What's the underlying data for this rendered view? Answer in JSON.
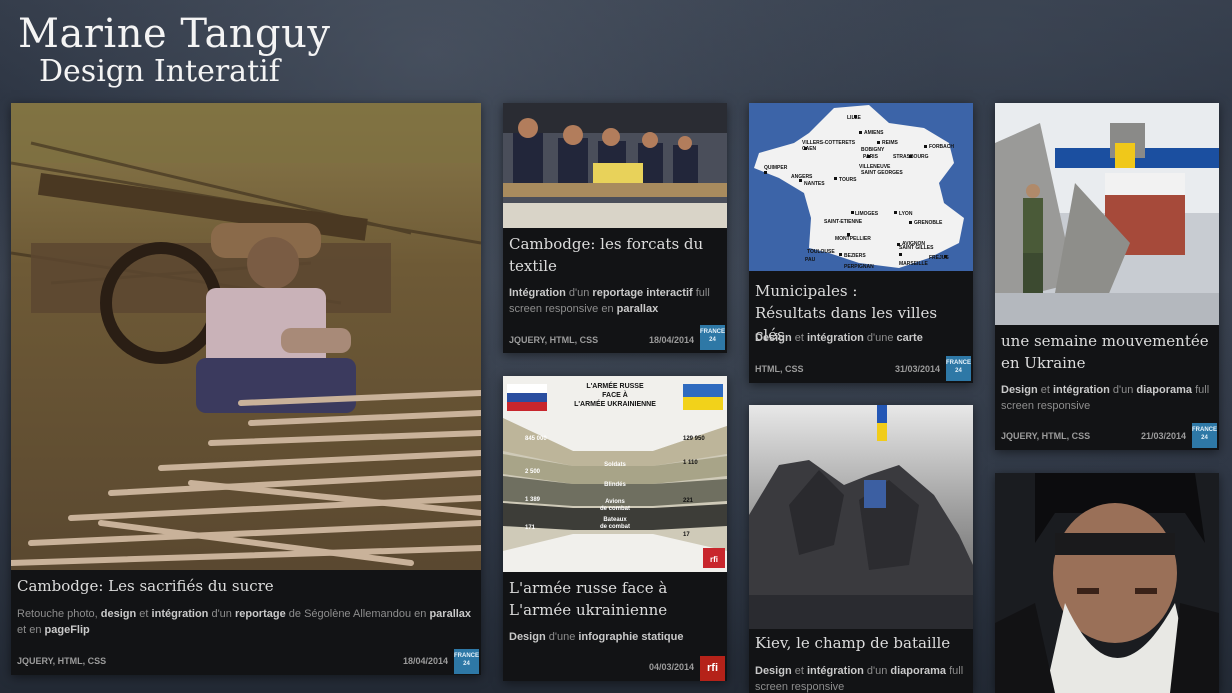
{
  "header": {
    "name": "Marine Tanguy",
    "subtitle": "Design Interatif"
  },
  "cards": [
    {
      "title": "Cambodge: Les sacrifiés du sucre",
      "desc": [
        {
          "t": "Retouche photo",
          "b": false
        },
        {
          "t": ", ",
          "b": false
        },
        {
          "t": "design",
          "b": true
        },
        {
          "t": " et ",
          "b": false
        },
        {
          "t": "intégration",
          "b": true
        },
        {
          "t": " d'un ",
          "b": false
        },
        {
          "t": "reportage",
          "b": true
        },
        {
          "t": " de Ségolène Allemandou en ",
          "b": false
        },
        {
          "t": "parallax",
          "b": true
        },
        {
          "t": " et en ",
          "b": false
        },
        {
          "t": "pageFlip",
          "b": true
        }
      ],
      "tags": "JQUERY, HTML, CSS",
      "date": "18/04/2014",
      "logo": "FRANCE 24"
    },
    {
      "title": "Cambodge: les forcats du textile",
      "desc": [
        {
          "t": "Intégration",
          "b": true
        },
        {
          "t": " d'un ",
          "b": false
        },
        {
          "t": "reportage interactif",
          "b": true
        },
        {
          "t": " full screen responsive en ",
          "b": false
        },
        {
          "t": "parallax",
          "b": true
        }
      ],
      "tags": "JQUERY, HTML, CSS",
      "date": "18/04/2014",
      "logo": "FRANCE 24"
    },
    {
      "title": "L'armée russe face à L'armée ukrainienne",
      "desc": [
        {
          "t": "Design",
          "b": true
        },
        {
          "t": " d'une ",
          "b": false
        },
        {
          "t": "infographie statique",
          "b": true
        }
      ],
      "tags": "",
      "date": "04/03/2014",
      "logo": "rfi"
    },
    {
      "title_lines": [
        "Municipales :",
        "Résultats dans les villes clés"
      ],
      "desc": [
        {
          "t": "Design",
          "b": true
        },
        {
          "t": " et ",
          "b": false
        },
        {
          "t": "intégration",
          "b": true
        },
        {
          "t": " d'une ",
          "b": false
        },
        {
          "t": "carte",
          "b": true
        }
      ],
      "tags": "HTML, CSS",
      "date": "31/03/2014",
      "logo": "FRANCE 24"
    },
    {
      "title": "Kiev, le champ de bataille",
      "desc": [
        {
          "t": "Design",
          "b": true
        },
        {
          "t": " et ",
          "b": false
        },
        {
          "t": "intégration",
          "b": true
        },
        {
          "t": " d'un ",
          "b": false
        },
        {
          "t": "diaporama",
          "b": true
        },
        {
          "t": " full screen responsive",
          "b": false
        }
      ],
      "tags": "",
      "date": "",
      "logo": ""
    },
    {
      "title": "une semaine mouvementée en Ukraine",
      "desc": [
        {
          "t": "Design",
          "b": true
        },
        {
          "t": " et ",
          "b": false
        },
        {
          "t": "intégration",
          "b": true
        },
        {
          "t": " d'un ",
          "b": false
        },
        {
          "t": "diaporama",
          "b": true
        },
        {
          "t": " full screen responsive",
          "b": false
        }
      ],
      "tags": "JQUERY, HTML, CSS",
      "date": "21/03/2014",
      "logo": "FRANCE 24"
    }
  ],
  "infographic": {
    "heading": "L'ARMÉE RUSSE FACE À L'ARMÉE UKRAINIENNE",
    "rows": [
      {
        "label": "Soldats",
        "left": "845 000",
        "right": "129 950"
      },
      {
        "label": "Blindés",
        "left": "2 500",
        "right": "1 110"
      },
      {
        "label": "Avions de combat",
        "left": "1 389",
        "right": "221"
      },
      {
        "label": "Bateaux de combat",
        "left": "171",
        "right": "17"
      }
    ]
  },
  "map_cities": [
    "LILLE",
    "AMIENS",
    "REIMS",
    "FORBACH",
    "CAEN",
    "VILLERS-COTTERETS",
    "BOBIGNY",
    "PARIS",
    "STRASBOURG",
    "QUIMPER",
    "ANGERS",
    "NANTES",
    "TOURS",
    "VILLENEUVE SAINT GEORGES",
    "LIMOGES",
    "LYON",
    "GRENOBLE",
    "SAINT-ETIENNE",
    "MONTPELLIER",
    "AVIGNON",
    "TOULOUSE",
    "BEZIERS",
    "SAINT GILLES",
    "FREJUS",
    "PAU",
    "MARSEILLE",
    "PERPIGNAN"
  ],
  "colors": {
    "card_bg": "#121315",
    "accent_f24": "#2e78a6",
    "accent_rfi": "#b52219"
  }
}
